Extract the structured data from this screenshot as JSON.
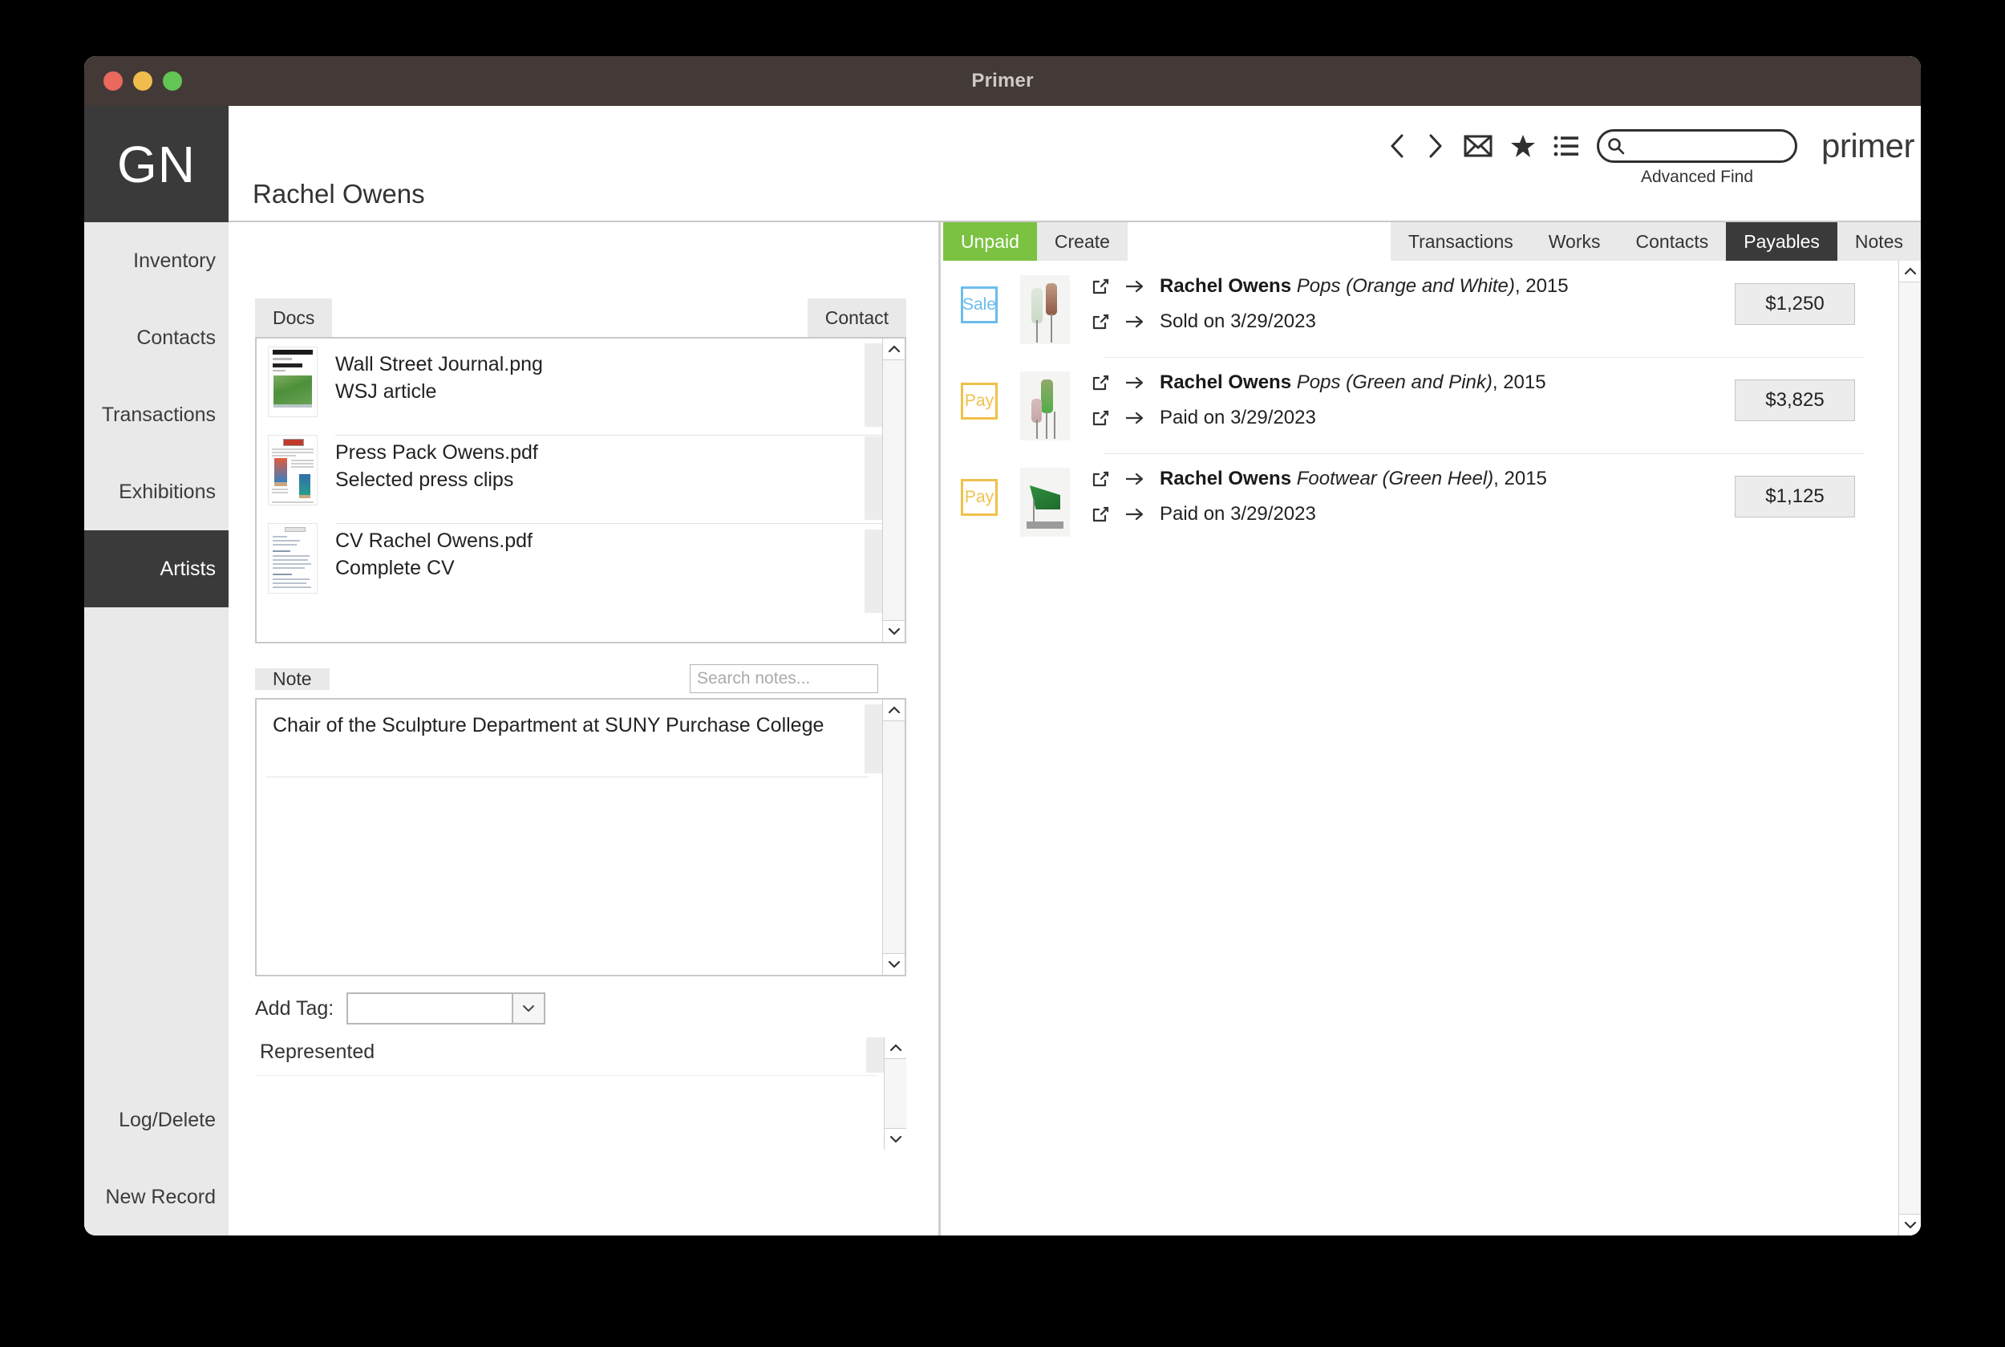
{
  "window": {
    "title": "Primer",
    "logo": "GN",
    "brand": "primer"
  },
  "header": {
    "record_title": "Rachel Owens",
    "advanced_find": "Advanced Find",
    "search_value": "",
    "search_placeholder": "",
    "icons": [
      "back-chevron-icon",
      "forward-chevron-icon",
      "envelope-icon",
      "star-icon",
      "list-icon",
      "search-icon"
    ]
  },
  "sidebar": {
    "items": [
      {
        "label": "Inventory",
        "active": false
      },
      {
        "label": "Contacts",
        "active": false
      },
      {
        "label": "Transactions",
        "active": false
      },
      {
        "label": "Exhibitions",
        "active": false
      },
      {
        "label": "Artists",
        "active": true
      }
    ],
    "bottom_items": [
      {
        "label": "Log/Delete"
      },
      {
        "label": "New Record"
      }
    ]
  },
  "docs_panel": {
    "tab_label": "Docs",
    "contact_tab_label": "Contact",
    "rows": [
      {
        "title": "Wall Street Journal.png",
        "subtitle": "WSJ article",
        "thumb": "wsj-thumb"
      },
      {
        "title": "Press Pack Owens.pdf",
        "subtitle": "Selected press clips",
        "thumb": "press-pack-thumb"
      },
      {
        "title": "CV Rachel Owens.pdf",
        "subtitle": "Complete CV",
        "thumb": "cv-thumb"
      }
    ]
  },
  "note_panel": {
    "tab_label": "Note",
    "search_value": "",
    "search_placeholder": "Search notes...",
    "note_text": "Chair of the Sculpture Department at SUNY Purchase College"
  },
  "tag_panel": {
    "label": "Add Tag:",
    "selected_value": "",
    "tags": [
      "Represented"
    ]
  },
  "right_panel": {
    "left_tabs": [
      {
        "label": "Unpaid",
        "style": "green"
      },
      {
        "label": "Create",
        "style": "flat"
      }
    ],
    "right_tabs": [
      {
        "label": "Transactions",
        "style": "flat"
      },
      {
        "label": "Works",
        "style": "flat"
      },
      {
        "label": "Contacts",
        "style": "flat"
      },
      {
        "label": "Payables",
        "style": "dark"
      },
      {
        "label": "Notes",
        "style": "flat"
      }
    ],
    "payables": [
      {
        "badge": "Sale",
        "badge_type": "sale",
        "artist": "Rachel Owens",
        "work": "Pops (Orange and White)",
        "year": "2015",
        "status": "Sold on 3/29/2023",
        "amount": "$1,250",
        "thumb": "glass-orange-white"
      },
      {
        "badge": "Pay",
        "badge_type": "pay",
        "artist": "Rachel Owens",
        "work": "Pops (Green and Pink)",
        "year": "2015",
        "status": "Paid on 3/29/2023",
        "amount": "$3,825",
        "thumb": "glass-green-pink"
      },
      {
        "badge": "Pay",
        "badge_type": "pay",
        "artist": "Rachel Owens",
        "work": "Footwear (Green Heel)",
        "year": "2015",
        "status": "Paid on 3/29/2023",
        "amount": "$1,125",
        "thumb": "glass-green-heel"
      }
    ]
  },
  "colors": {
    "titlebar": "#433a37",
    "sidebar_bg": "#e9e9e9",
    "active_tab": "#3a3a3a",
    "unpaid_green": "#7cc242",
    "sale_blue": "#6cbcec",
    "pay_amber": "#f0c14b"
  }
}
